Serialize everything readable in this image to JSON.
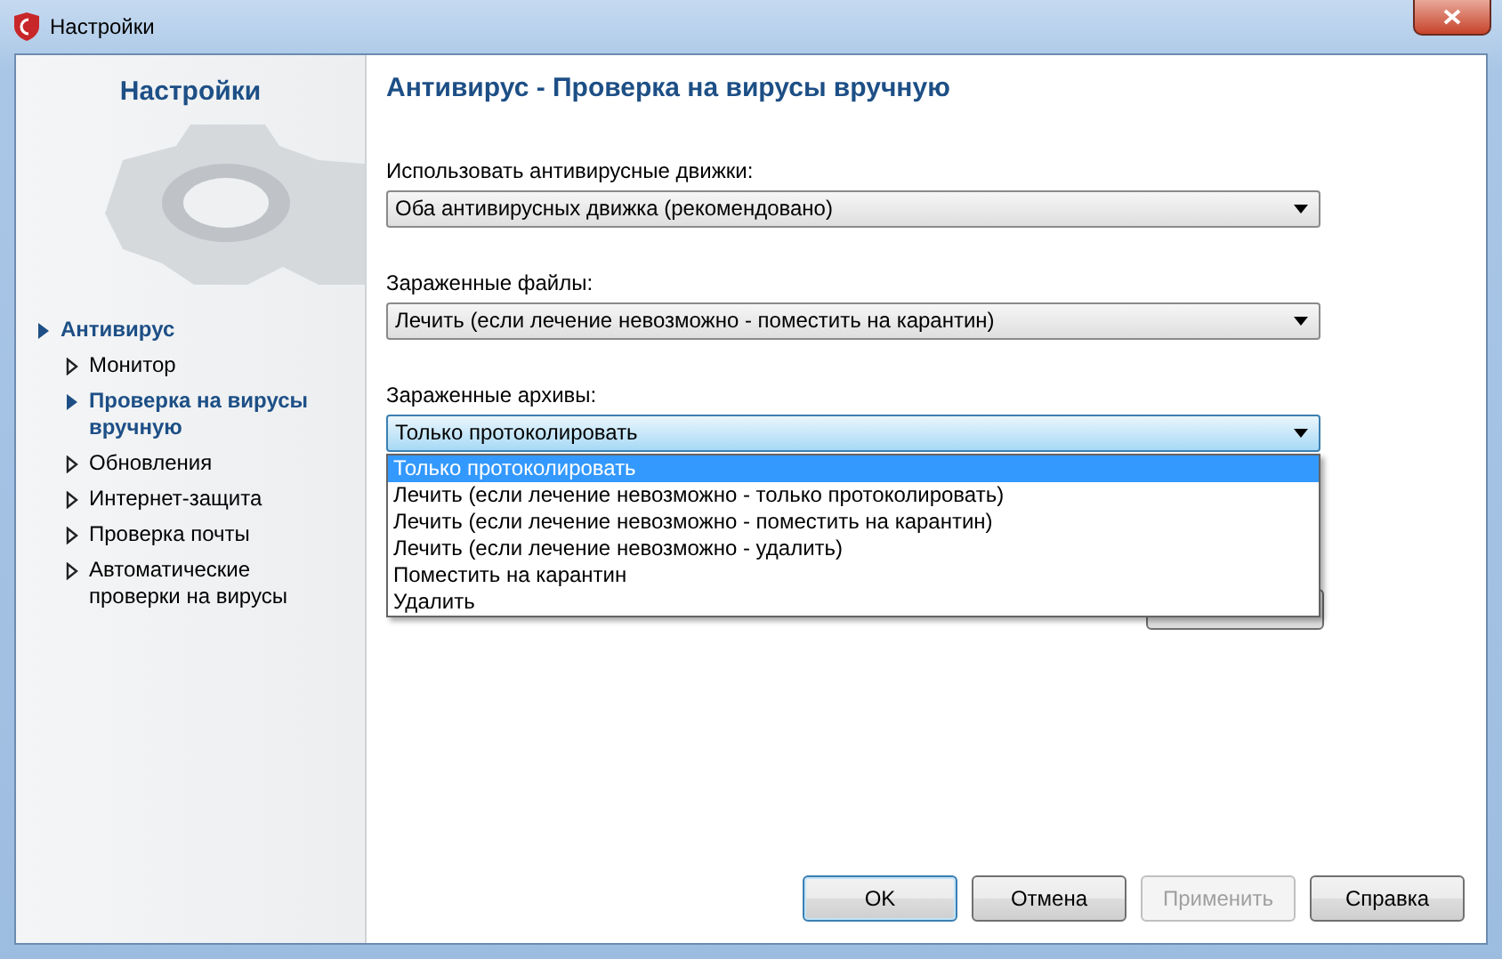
{
  "window": {
    "title": "Настройки"
  },
  "sidebar": {
    "title": "Настройки",
    "items": [
      {
        "label": "Антивирус",
        "expanded": true,
        "children": [
          {
            "label": "Монитор",
            "selected": false
          },
          {
            "label": "Проверка на вирусы вручную",
            "selected": true
          },
          {
            "label": "Обновления",
            "selected": false
          },
          {
            "label": "Интернет-защита",
            "selected": false
          },
          {
            "label": "Проверка почты",
            "selected": false
          },
          {
            "label": "Автоматические проверки на вирусы",
            "selected": false
          }
        ]
      }
    ]
  },
  "page": {
    "title": "Антивирус - Проверка на вирусы вручную",
    "fields": [
      {
        "label": "Использовать антивирусные движки:",
        "value": "Оба антивирусных движка (рекомендовано)",
        "open": false
      },
      {
        "label": "Зараженные файлы:",
        "value": "Лечить (если лечение невозможно - поместить на карантин)",
        "open": false
      },
      {
        "label": "Зараженные архивы:",
        "value": "Только протоколировать",
        "open": true,
        "options": [
          {
            "label": "Только протоколировать",
            "selected": true
          },
          {
            "label": "Лечить (если лечение невозможно - только протоколировать)",
            "selected": false
          },
          {
            "label": "Лечить (если лечение невозможно - поместить на карантин)",
            "selected": false
          },
          {
            "label": "Лечить (если лечение невозможно - удалить)",
            "selected": false
          },
          {
            "label": "Поместить на карантин",
            "selected": false
          },
          {
            "label": "Удалить",
            "selected": false
          }
        ]
      }
    ]
  },
  "buttons": [
    {
      "label": "OK",
      "default": true,
      "disabled": false
    },
    {
      "label": "Отмена",
      "default": false,
      "disabled": false
    },
    {
      "label": "Применить",
      "default": false,
      "disabled": true
    },
    {
      "label": "Справка",
      "default": false,
      "disabled": false
    }
  ]
}
